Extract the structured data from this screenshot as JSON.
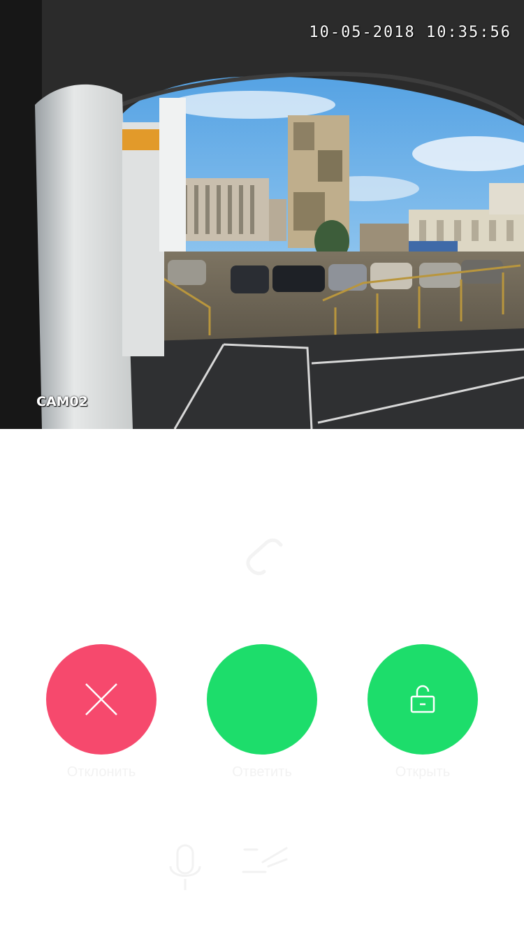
{
  "camera": {
    "timestamp": "10-05-2018 10:35:56",
    "label": "CAM02"
  },
  "call": {
    "icon": "phone-icon"
  },
  "actions": [
    {
      "label": "Отклонить",
      "icon": "close-icon",
      "color": "#f6496d"
    },
    {
      "label": "Ответить",
      "icon": "phone-answer-icon",
      "color": "#1ddd6b"
    },
    {
      "label": "Открыть",
      "icon": "unlock-icon",
      "color": "#1ddd6b"
    }
  ],
  "controls": [
    {
      "icon": "microphone-icon"
    },
    {
      "icon": "mute-icon"
    }
  ]
}
